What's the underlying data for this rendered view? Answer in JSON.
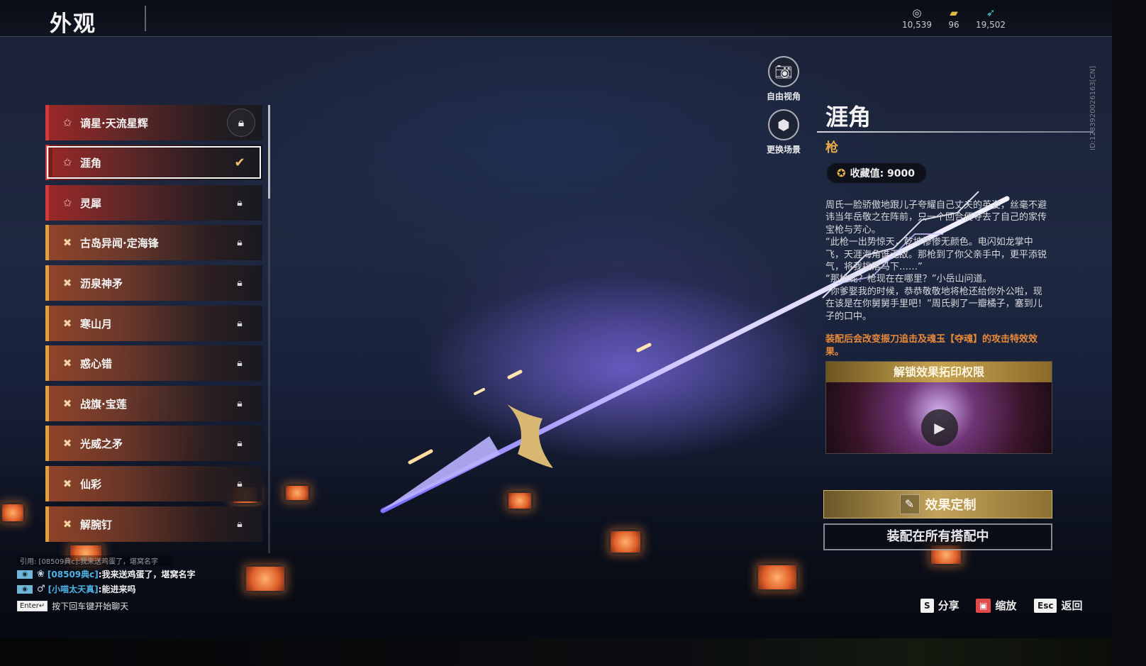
{
  "header": {
    "title": "外观",
    "currencies": [
      {
        "icon": "coins-icon",
        "value": "10,539"
      },
      {
        "icon": "ticket-icon",
        "value": "96"
      },
      {
        "icon": "feather-icon",
        "value": "19,502"
      }
    ]
  },
  "list": {
    "items": [
      {
        "label": "谪星·天流星辉",
        "rarity": "red",
        "state": "locked-ring"
      },
      {
        "label": "涯角",
        "rarity": "red",
        "state": "equipped",
        "selected": true
      },
      {
        "label": "灵犀",
        "rarity": "red",
        "state": "locked"
      },
      {
        "label": "古岛异闻·定海锋",
        "rarity": "gold",
        "state": "locked"
      },
      {
        "label": "沥泉神矛",
        "rarity": "gold",
        "state": "locked"
      },
      {
        "label": "寒山月",
        "rarity": "gold",
        "state": "locked"
      },
      {
        "label": "惑心错",
        "rarity": "gold",
        "state": "locked"
      },
      {
        "label": "战旗·宝莲",
        "rarity": "gold",
        "state": "locked"
      },
      {
        "label": "光威之矛",
        "rarity": "gold",
        "state": "locked"
      },
      {
        "label": "仙彩",
        "rarity": "gold",
        "state": "locked"
      },
      {
        "label": "解腕钉",
        "rarity": "gold",
        "state": "locked"
      }
    ]
  },
  "view_buttons": {
    "free_camera": "自由视角",
    "change_scene": "更换场景"
  },
  "detail": {
    "name": "涯角",
    "type": "枪",
    "collection_label": "收藏值: 9000",
    "lore": [
      "周氏一脸骄傲地跟儿子夸耀自己丈夫的英姿，丝毫不避讳当年岳敬之在阵前，只一个回合便夺去了自己的家传宝枪与芳心。",
      "“此枪一出势惊天，乾坤惨惨无颜色。电闪如龙掌中飞，天涯海角谁无敌。那枪到了你父亲手中，更平添锐气，将我挑落马下……”",
      "“那枪呢？枪现在在哪里？”小岳山问道。",
      "“你爹娶我的时候，恭恭敬敬地将枪还给你外公啦，现在该是在你舅舅手里吧！”周氏剥了一瓣橘子，塞到儿子的口中。"
    ],
    "effect_note": "装配后会改变振刀追击及魂玉【夺魂】的攻击特效效果。",
    "preview_title": "解锁效果拓印权限",
    "customize_label": "效果定制",
    "equip_all_label": "装配在所有搭配中"
  },
  "chat": {
    "quote": "引用: [08509典c]:我来送鸡蛋了，堪窝名字",
    "messages": [
      {
        "name": "[08509典c]",
        "text": ":我来送鸡蛋了，堪窝名字"
      },
      {
        "name": "[小喵太天真]",
        "text": ":能进来吗"
      }
    ],
    "enter_key": "Enter↵",
    "enter_hint": "按下回车键开始聊天"
  },
  "hints": {
    "share_key": "S",
    "share_label": "分享",
    "zoom_label": "缩放",
    "back_key": "Esc",
    "back_label": "返回"
  },
  "side_id": "ID:1283920026163[CN]",
  "colors": {
    "accent_gold": "#e6a94a",
    "note_orange": "#e8893a",
    "rarity_red": "#d23a3c",
    "rarity_gold": "#e0a040"
  }
}
